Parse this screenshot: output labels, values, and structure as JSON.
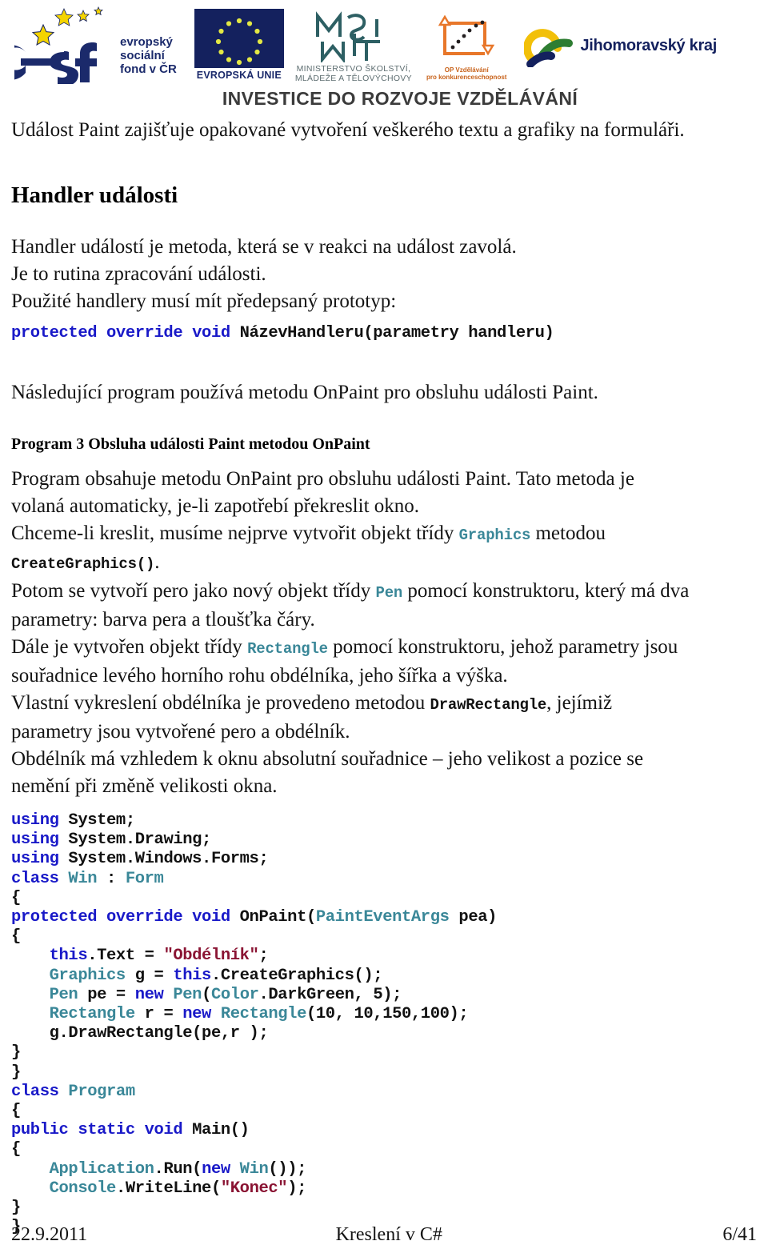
{
  "header": {
    "logos": [
      {
        "name": "esf",
        "text_lines": [
          "evropský",
          "sociální",
          "fond v ČR"
        ]
      },
      {
        "name": "eu",
        "label": "EVROPSKÁ UNIE"
      },
      {
        "name": "msmt",
        "label_lines": [
          "MINISTERSTVO ŠKOLSTVÍ,",
          "MLÁDEŽE A TĚLOVÝCHOVY"
        ]
      },
      {
        "name": "op-vzdelavani",
        "label_lines": [
          "OP Vzdělávání",
          "pro konkurenceschopnost"
        ]
      },
      {
        "name": "jihomoravsky-kraj",
        "label": "Jihomoravský kraj"
      }
    ],
    "slogan": "INVESTICE DO ROZVOJE VZDĚLÁVÁNÍ",
    "colors": {
      "esf_navy": "#1b2a6b",
      "eu_navy": "#14215e",
      "eu_star_yellow": "#e3e844",
      "msmt_teal": "#2d5f63",
      "opvk_orange": "#e8772a",
      "jmk_yellow": "#f2c009",
      "jmk_green": "#2e7d32",
      "jmk_navy": "#14215e"
    }
  },
  "body": {
    "intro_line": "Událost Paint zajišťuje opakované vytvoření veškerého textu a grafiky na formuláři.",
    "section_heading": "Handler události",
    "paragraphs_1": [
      "Handler událostí je metoda, která se v reakci na událost zavolá.",
      "Je to rutina zpracování události.",
      "Použité handlery musí mít předepsaný prototyp:"
    ],
    "prototype": {
      "keywords": "protected override void ",
      "rest": "NázevHandleru(parametry handleru)"
    },
    "after_prototype": "Následující program používá metodu OnPaint pro obsluhu události Paint.",
    "program_heading": "Program 3 Obsluha události Paint metodou OnPaint",
    "description": {
      "l1": "Program obsahuje metodu OnPaint pro obsluhu události Paint. Tato metoda je",
      "l2": "volaná automaticky, je-li zapotřebí překreslit okno.",
      "l3a": "Chceme-li kreslit, musíme nejprve vytvořit objekt třídy ",
      "l3code": "Graphics",
      "l3b": " metodou",
      "l4code": "CreateGraphics()",
      "l4b": ".",
      "l5a": "Potom se vytvoří pero jako nový objekt třídy ",
      "l5code": "Pen",
      "l5b": " pomocí konstruktoru, který má dva",
      "l6": "parametry: barva pera a tloušťka čáry.",
      "l7a": "Dále je vytvořen objekt třídy ",
      "l7code": "Rectangle",
      "l7b": "  pomocí konstruktoru, jehož parametry jsou",
      "l8": "souřadnice levého horního rohu obdélníka, jeho šířka a výška.",
      "l9a": "Vlastní vykreslení obdélníka je provedeno metodou  ",
      "l9code": "DrawRectangle",
      "l9b": ", jejímiž",
      "l10": "parametry jsou vytvořené pero a obdélník.",
      "l11": "Obdélník má vzhledem k oknu absolutní souřadnice – jeho velikost a pozice se",
      "l12": "nemění při změně velikosti okna."
    }
  },
  "code": {
    "language": "csharp",
    "colors": {
      "keyword": "#1919c8",
      "type": "#3a8798",
      "string": "#8a1433",
      "plain": "#111111"
    },
    "lines": [
      [
        {
          "t": "using ",
          "c": "kw"
        },
        {
          "t": "System;",
          "c": "pl"
        }
      ],
      [
        {
          "t": "using ",
          "c": "kw"
        },
        {
          "t": "System.Drawing;",
          "c": "pl"
        }
      ],
      [
        {
          "t": "using ",
          "c": "kw"
        },
        {
          "t": "System.Windows.Forms;",
          "c": "pl"
        }
      ],
      [
        {
          "t": "class ",
          "c": "kw"
        },
        {
          "t": "Win ",
          "c": "ty"
        },
        {
          "t": ": ",
          "c": "pl"
        },
        {
          "t": "Form",
          "c": "ty"
        }
      ],
      [
        {
          "t": "{",
          "c": "pl"
        }
      ],
      [
        {
          "t": "protected override void ",
          "c": "kw"
        },
        {
          "t": "OnPaint(",
          "c": "pl"
        },
        {
          "t": "PaintEventArgs",
          "c": "ty"
        },
        {
          "t": " pea)",
          "c": "pl"
        }
      ],
      [
        {
          "t": "{",
          "c": "pl"
        }
      ],
      [
        {
          "t": "    ",
          "c": "pl"
        },
        {
          "t": "this",
          "c": "kw"
        },
        {
          "t": ".Text = ",
          "c": "pl"
        },
        {
          "t": "\"Obdélník\"",
          "c": "str"
        },
        {
          "t": ";",
          "c": "pl"
        }
      ],
      [
        {
          "t": "    ",
          "c": "pl"
        },
        {
          "t": "Graphics",
          "c": "ty"
        },
        {
          "t": " g = ",
          "c": "pl"
        },
        {
          "t": "this",
          "c": "kw"
        },
        {
          "t": ".CreateGraphics();",
          "c": "pl"
        }
      ],
      [
        {
          "t": "    ",
          "c": "pl"
        },
        {
          "t": "Pen",
          "c": "ty"
        },
        {
          "t": " pe = ",
          "c": "pl"
        },
        {
          "t": "new ",
          "c": "kw"
        },
        {
          "t": "Pen",
          "c": "ty"
        },
        {
          "t": "(",
          "c": "pl"
        },
        {
          "t": "Color",
          "c": "ty"
        },
        {
          "t": ".DarkGreen, 5);",
          "c": "pl"
        }
      ],
      [
        {
          "t": "    ",
          "c": "pl"
        },
        {
          "t": "Rectangle",
          "c": "ty"
        },
        {
          "t": " r = ",
          "c": "pl"
        },
        {
          "t": "new ",
          "c": "kw"
        },
        {
          "t": "Rectangle",
          "c": "ty"
        },
        {
          "t": "(10, 10,150,100);",
          "c": "pl"
        }
      ],
      [
        {
          "t": "    g.DrawRectangle(pe,r );",
          "c": "pl"
        }
      ],
      [
        {
          "t": "}",
          "c": "pl"
        }
      ],
      [
        {
          "t": "}",
          "c": "pl"
        }
      ],
      [
        {
          "t": "class ",
          "c": "kw"
        },
        {
          "t": "Program",
          "c": "ty"
        }
      ],
      [
        {
          "t": "{",
          "c": "pl"
        }
      ],
      [
        {
          "t": "public static void ",
          "c": "kw"
        },
        {
          "t": "Main()",
          "c": "pl"
        }
      ],
      [
        {
          "t": "{",
          "c": "pl"
        }
      ],
      [
        {
          "t": "    ",
          "c": "pl"
        },
        {
          "t": "Application",
          "c": "ty"
        },
        {
          "t": ".Run(",
          "c": "pl"
        },
        {
          "t": "new ",
          "c": "kw"
        },
        {
          "t": "Win",
          "c": "ty"
        },
        {
          "t": "());",
          "c": "pl"
        }
      ],
      [
        {
          "t": "    ",
          "c": "pl"
        },
        {
          "t": "Console",
          "c": "ty"
        },
        {
          "t": ".WriteLine(",
          "c": "pl"
        },
        {
          "t": "\"Konec\"",
          "c": "str"
        },
        {
          "t": ");",
          "c": "pl"
        }
      ],
      [
        {
          "t": "}",
          "c": "pl"
        }
      ],
      [
        {
          "t": "}",
          "c": "pl"
        }
      ]
    ]
  },
  "footer": {
    "date": "22.9.2011",
    "title": "Kreslení v C#",
    "page": "6/41"
  }
}
